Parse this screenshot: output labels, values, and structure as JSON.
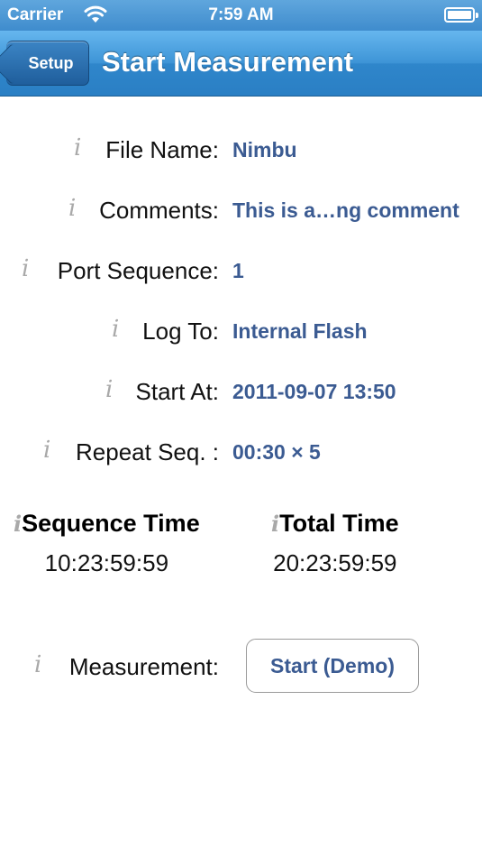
{
  "status_bar": {
    "carrier": "Carrier",
    "time": "7:59 AM",
    "wifi_icon": "wifi-icon",
    "battery_level": 1.0
  },
  "nav": {
    "back_label": "Setup",
    "title": "Start Measurement"
  },
  "info_glyph": "i",
  "fields": [
    {
      "label": "File Name:",
      "value": "Nimbu"
    },
    {
      "label": "Comments:",
      "value": "This is a…ng comment"
    },
    {
      "label": "Port Sequence:",
      "value": "1"
    },
    {
      "label": "Log To:",
      "value": "Internal Flash"
    },
    {
      "label": "Start At:",
      "value": "2011-09-07 13:50"
    },
    {
      "label": "Repeat Seq. :",
      "value": "00:30 × 5"
    }
  ],
  "sequence_time": {
    "title": "Sequence Time",
    "value": "10:23:59:59"
  },
  "total_time": {
    "title": "Total Time",
    "value": "20:23:59:59"
  },
  "measurement": {
    "label": "Measurement:",
    "button_label": "Start (Demo)"
  },
  "colors": {
    "nav_blue": "#3d94d6",
    "value_blue": "#3b5b92",
    "info_gray": "#a9a9a9"
  }
}
